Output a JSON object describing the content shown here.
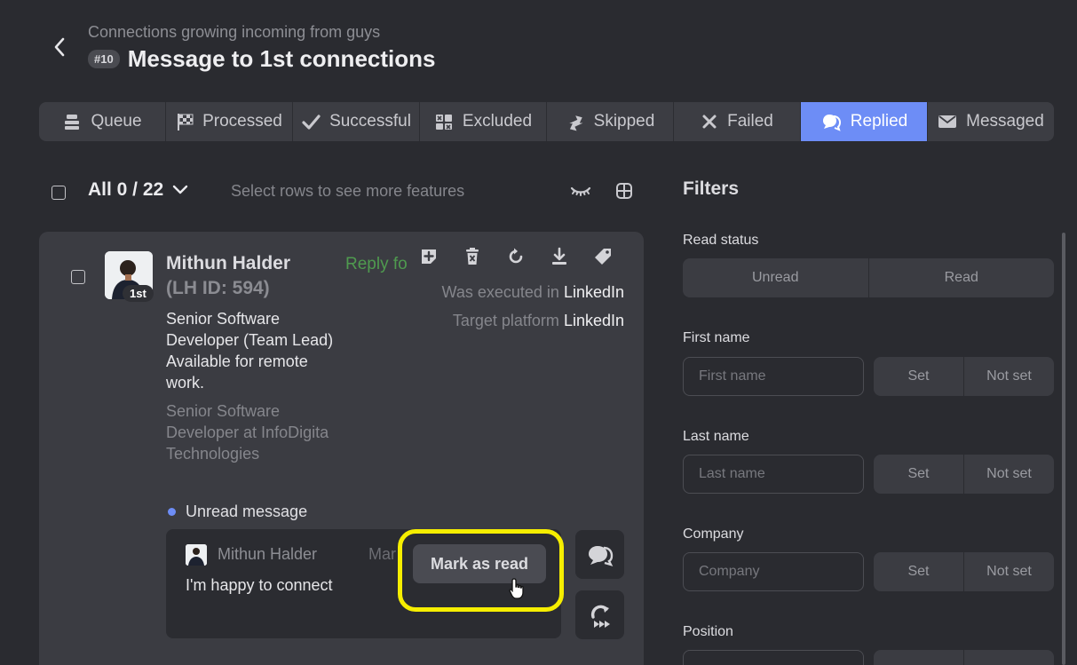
{
  "header": {
    "subtitle": "Connections growing incoming from guys",
    "id_badge": "#10",
    "title": "Message to 1st connections"
  },
  "tabs": [
    {
      "label": "Queue",
      "icon": "queue-icon"
    },
    {
      "label": "Processed",
      "icon": "checkered-flag-icon"
    },
    {
      "label": "Successful",
      "icon": "checkmark-icon"
    },
    {
      "label": "Excluded",
      "icon": "excluded-icon"
    },
    {
      "label": "Skipped",
      "icon": "skip-arrows-icon"
    },
    {
      "label": "Failed",
      "icon": "x-icon"
    },
    {
      "label": "Replied",
      "icon": "chat-bubbles-icon",
      "active": true
    },
    {
      "label": "Messaged",
      "icon": "envelope-icon"
    }
  ],
  "toolbar": {
    "all_count": "All 0 / 22",
    "select_hint": "Select rows to see more features"
  },
  "card": {
    "name": "Mithun Halder",
    "lh_id": "(LH ID: 594)",
    "degree": "1st",
    "reply_tag": "Reply fo",
    "headline": "Senior Software Developer (Team Lead) Available for remote work.",
    "position": "Senior Software Developer at InfoDigita Technologies",
    "executed_label": "Was executed in",
    "executed_value": "LinkedIn",
    "target_label": "Target platform",
    "target_value": "LinkedIn",
    "unread_label": "Unread message",
    "message": {
      "sender": "Mithun Halder",
      "date": "Mar",
      "text": "I'm happy to connect",
      "mark_read_label": "Mark as read"
    }
  },
  "filters": {
    "title": "Filters",
    "read_status": {
      "label": "Read status",
      "options": [
        "Unread",
        "Read"
      ]
    },
    "first_name": {
      "label": "First name",
      "placeholder": "First name"
    },
    "last_name": {
      "label": "Last name",
      "placeholder": "Last name"
    },
    "company": {
      "label": "Company",
      "placeholder": "Company"
    },
    "position": {
      "label": "Position"
    },
    "set_label": "Set",
    "not_set_label": "Not set"
  },
  "colors": {
    "accent": "#6d8df6",
    "background": "#2a2b30",
    "card": "#3b3c42",
    "highlight": "#f6ee00",
    "reply_green": "#4f9a4f"
  }
}
